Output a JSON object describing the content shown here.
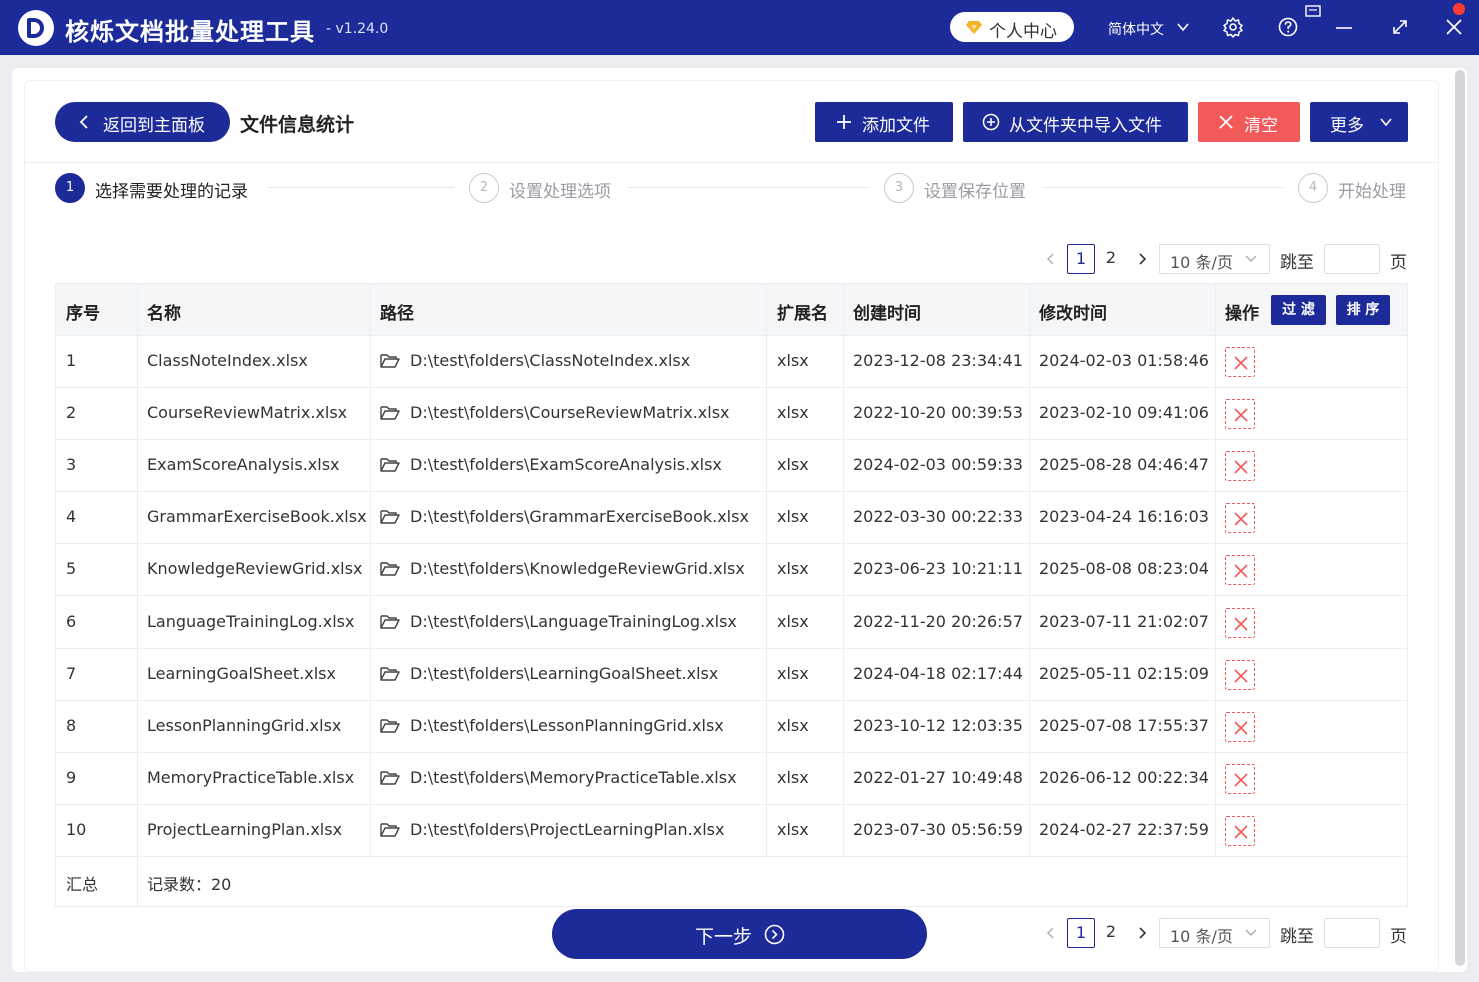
{
  "app": {
    "title": "核烁文档批量处理工具",
    "version": "- v1.24.0",
    "user_center": "个人中心",
    "language": "简体中文"
  },
  "toolbar": {
    "back_label": "返回到主面板",
    "page_title": "文件信息统计",
    "add_files": "添加文件",
    "import_folder": "从文件夹中导入文件",
    "clear": "清空",
    "more": "更多"
  },
  "steps": [
    {
      "num": "1",
      "label": "选择需要处理的记录"
    },
    {
      "num": "2",
      "label": "设置处理选项"
    },
    {
      "num": "3",
      "label": "设置保存位置"
    },
    {
      "num": "4",
      "label": "开始处理"
    }
  ],
  "pagination": {
    "pages": [
      "1",
      "2"
    ],
    "current_page": "1",
    "page_size": "10 条/页",
    "jump_label": "跳至",
    "page_suffix": "页"
  },
  "table": {
    "headers": {
      "index": "序号",
      "name": "名称",
      "path": "路径",
      "ext": "扩展名",
      "created": "创建时间",
      "modified": "修改时间",
      "actions": "操作",
      "filter": "过 滤",
      "sort": "排 序"
    },
    "rows": [
      {
        "index": "1",
        "name": "ClassNoteIndex.xlsx",
        "path": "D:\\test\\folders\\ClassNoteIndex.xlsx",
        "ext": "xlsx",
        "created": "2023-12-08 23:34:41",
        "modified": "2024-02-03 01:58:46"
      },
      {
        "index": "2",
        "name": "CourseReviewMatrix.xlsx",
        "path": "D:\\test\\folders\\CourseReviewMatrix.xlsx",
        "ext": "xlsx",
        "created": "2022-10-20 00:39:53",
        "modified": "2023-02-10 09:41:06"
      },
      {
        "index": "3",
        "name": "ExamScoreAnalysis.xlsx",
        "path": "D:\\test\\folders\\ExamScoreAnalysis.xlsx",
        "ext": "xlsx",
        "created": "2024-02-03 00:59:33",
        "modified": "2025-08-28 04:46:47"
      },
      {
        "index": "4",
        "name": "GrammarExerciseBook.xlsx",
        "path": "D:\\test\\folders\\GrammarExerciseBook.xlsx",
        "ext": "xlsx",
        "created": "2022-03-30 00:22:33",
        "modified": "2023-04-24 16:16:03"
      },
      {
        "index": "5",
        "name": "KnowledgeReviewGrid.xlsx",
        "path": "D:\\test\\folders\\KnowledgeReviewGrid.xlsx",
        "ext": "xlsx",
        "created": "2023-06-23 10:21:11",
        "modified": "2025-08-08 08:23:04"
      },
      {
        "index": "6",
        "name": "LanguageTrainingLog.xlsx",
        "path": "D:\\test\\folders\\LanguageTrainingLog.xlsx",
        "ext": "xlsx",
        "created": "2022-11-20 20:26:57",
        "modified": "2023-07-11 21:02:07"
      },
      {
        "index": "7",
        "name": "LearningGoalSheet.xlsx",
        "path": "D:\\test\\folders\\LearningGoalSheet.xlsx",
        "ext": "xlsx",
        "created": "2024-04-18 02:17:44",
        "modified": "2025-05-11 02:15:09"
      },
      {
        "index": "8",
        "name": "LessonPlanningGrid.xlsx",
        "path": "D:\\test\\folders\\LessonPlanningGrid.xlsx",
        "ext": "xlsx",
        "created": "2023-10-12 12:03:35",
        "modified": "2025-07-08 17:55:37"
      },
      {
        "index": "9",
        "name": "MemoryPracticeTable.xlsx",
        "path": "D:\\test\\folders\\MemoryPracticeTable.xlsx",
        "ext": "xlsx",
        "created": "2022-01-27 10:49:48",
        "modified": "2026-06-12 00:22:34"
      },
      {
        "index": "10",
        "name": "ProjectLearningPlan.xlsx",
        "path": "D:\\test\\folders\\ProjectLearningPlan.xlsx",
        "ext": "xlsx",
        "created": "2023-07-30 05:56:59",
        "modified": "2024-02-27 22:37:59"
      }
    ],
    "summary": {
      "label": "汇总",
      "value": "记录数：20"
    }
  },
  "next_button": "下一步",
  "colors": {
    "primary": "#1d2a9a",
    "danger": "#f25a5a"
  }
}
